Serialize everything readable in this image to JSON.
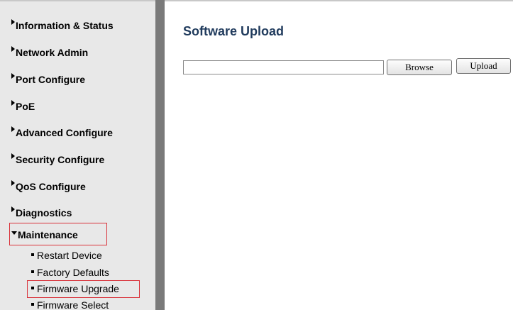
{
  "sidebar": {
    "items": [
      {
        "label": "Information & Status"
      },
      {
        "label": "Network Admin"
      },
      {
        "label": "Port Configure"
      },
      {
        "label": "PoE"
      },
      {
        "label": "Advanced Configure"
      },
      {
        "label": "Security Configure"
      },
      {
        "label": "QoS Configure"
      },
      {
        "label": "Diagnostics"
      },
      {
        "label": "Maintenance"
      }
    ],
    "maintenance_subitems": [
      {
        "label": "Restart Device"
      },
      {
        "label": "Factory Defaults"
      },
      {
        "label": "Firmware Upgrade"
      },
      {
        "label": "Firmware Select"
      }
    ]
  },
  "main": {
    "title": "Software Upload",
    "file_input_value": "",
    "browse_label": "Browse",
    "upload_label": "Upload"
  },
  "colors": {
    "title": "#1f3a5c",
    "highlight_box": "#d9323a",
    "sidebar_bg": "#e8e8e8",
    "divider": "#7a7a7a"
  }
}
